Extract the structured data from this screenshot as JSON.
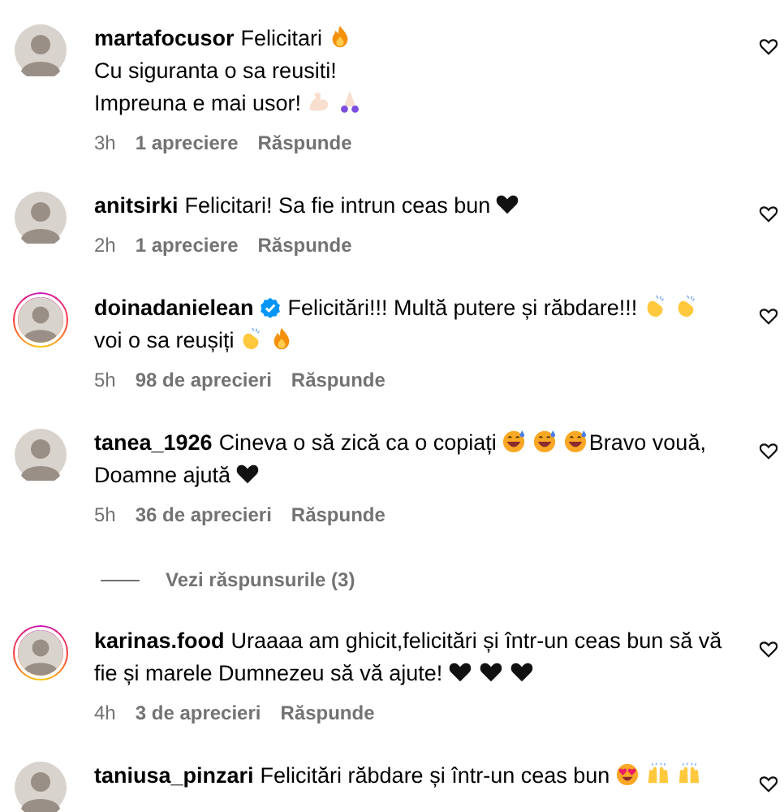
{
  "comments": [
    {
      "username": "martafocusor",
      "verified": false,
      "story_ring": false,
      "text": [
        {
          "kind": "text",
          "text": "Felicitari"
        },
        {
          "kind": "fire"
        },
        {
          "kind": "break"
        },
        {
          "kind": "text",
          "text": "Cu siguranta o sa reusiti!"
        },
        {
          "kind": "break"
        },
        {
          "kind": "text",
          "text": "Impreuna e mai usor!"
        },
        {
          "kind": "muscle"
        },
        {
          "kind": "pray"
        }
      ],
      "time": "3h",
      "likes": "1 apreciere",
      "reply": "Răspunde"
    },
    {
      "username": "anitsirki",
      "verified": false,
      "story_ring": false,
      "text": [
        {
          "kind": "text",
          "text": "Felicitari! Sa fie intrun ceas bun"
        },
        {
          "kind": "heart"
        }
      ],
      "time": "2h",
      "likes": "1 apreciere",
      "reply": "Răspunde"
    },
    {
      "username": "doinadanielean",
      "verified": true,
      "story_ring": true,
      "text": [
        {
          "kind": "text",
          "text": "Felicitări!!! Multă putere și răbdare!!!"
        },
        {
          "kind": "clap"
        },
        {
          "kind": "clap"
        },
        {
          "kind": "break"
        },
        {
          "kind": "text",
          "text": "voi o sa reușiți"
        },
        {
          "kind": "clap"
        },
        {
          "kind": "fire"
        }
      ],
      "time": "5h",
      "likes": "98 de aprecieri",
      "reply": "Răspunde"
    },
    {
      "username": "tanea_1926",
      "verified": false,
      "story_ring": false,
      "text": [
        {
          "kind": "text",
          "text": "Cineva o să zică ca o copiați"
        },
        {
          "kind": "sweatsmile"
        },
        {
          "kind": "sweatsmile"
        },
        {
          "kind": "sweatsmile"
        },
        {
          "kind": "text",
          "text": "Bravo vouă,"
        },
        {
          "kind": "break"
        },
        {
          "kind": "text",
          "text": "Doamne ajută"
        },
        {
          "kind": "heart"
        }
      ],
      "time": "5h",
      "likes": "36 de aprecieri",
      "reply": "Răspunde",
      "replies": "Vezi răspunsurile (3)"
    },
    {
      "username": "karinas.food",
      "verified": false,
      "story_ring": true,
      "text": [
        {
          "kind": "text",
          "text": "Uraaaa am ghicit,felicitări și într-un ceas bun să vă"
        },
        {
          "kind": "break"
        },
        {
          "kind": "text",
          "text": "fie și marele Dumnezeu să vă ajute!"
        },
        {
          "kind": "heart"
        },
        {
          "kind": "heart"
        },
        {
          "kind": "heart"
        }
      ],
      "time": "4h",
      "likes": "3 de aprecieri",
      "reply": "Răspunde"
    },
    {
      "username": "taniusa_pinzari",
      "verified": false,
      "story_ring": false,
      "text": [
        {
          "kind": "text",
          "text": "Felicitări răbdare și într-un ceas bun"
        },
        {
          "kind": "hearteyes"
        },
        {
          "kind": "hands"
        },
        {
          "kind": "hands"
        }
      ]
    }
  ]
}
